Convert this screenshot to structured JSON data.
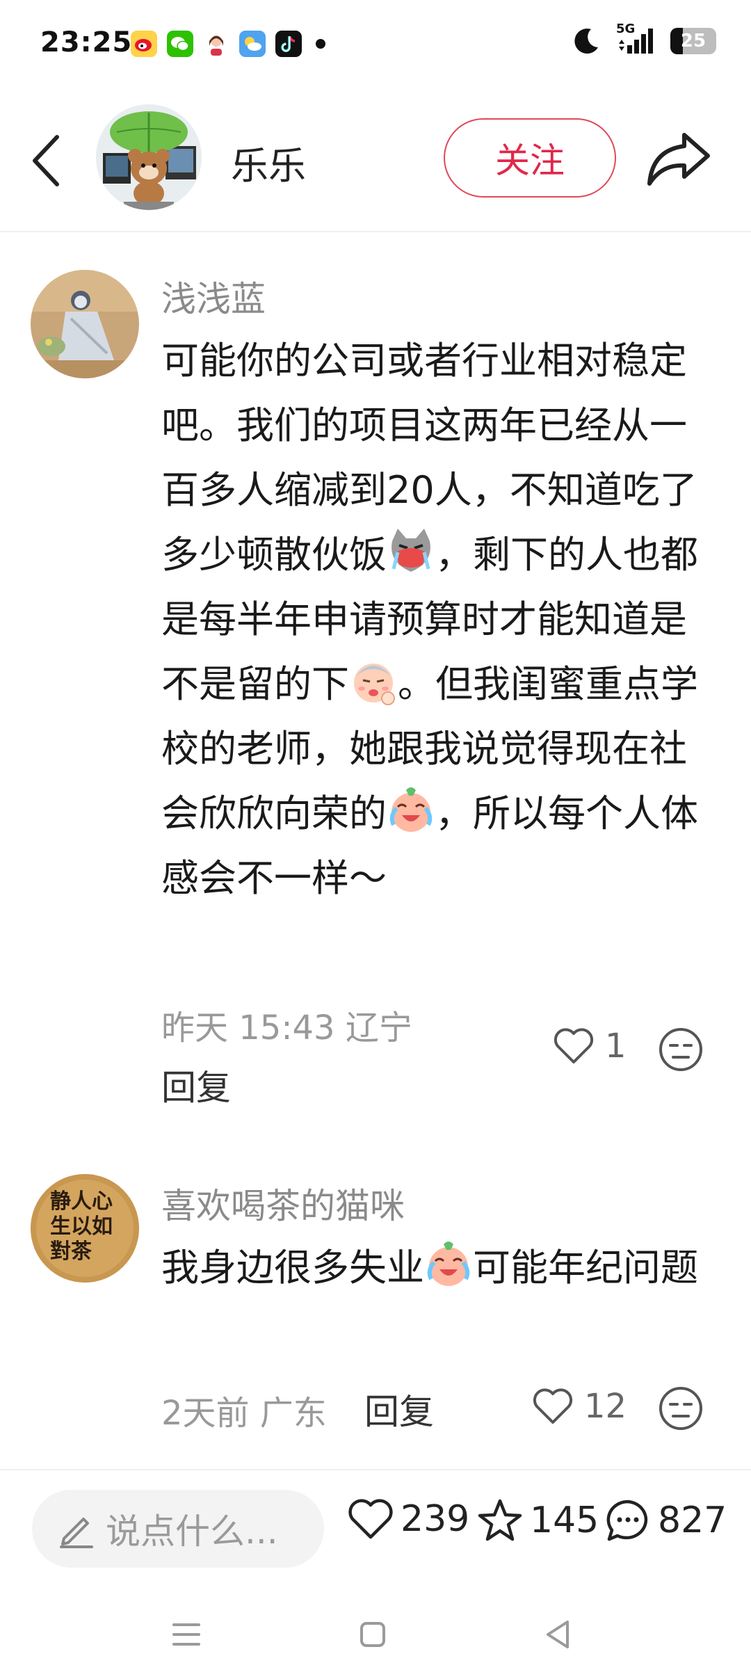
{
  "status_bar": {
    "time": "23:25",
    "network": "5G",
    "battery": "25",
    "app_icons": [
      "weibo-icon",
      "wechat-icon",
      "avatar-app-icon",
      "weather-icon",
      "tiktok-icon"
    ]
  },
  "header": {
    "username": "乐乐",
    "follow_label": "关注"
  },
  "comments": [
    {
      "author": "浅浅蓝",
      "text_parts": [
        "可能你的公司或者行业相对稳定吧。我们的项目这两年已经从一百多人缩减到20人，不知道吃了多少顿散伙饭",
        "，剩下的人也都是每半年申请预算时才能知道是不是留的下",
        "。但我闺蜜重点学校的老师，她跟我说觉得现在社会欣欣向荣的",
        "，所以每个人体感会不一样～"
      ],
      "meta": "昨天 15:43 辽宁",
      "reply_label": "回复",
      "likes": "1"
    },
    {
      "author": "喜欢喝茶的猫咪",
      "text_parts": [
        "我身边很多失业",
        "可能年纪问题"
      ],
      "meta": "2天前 广东",
      "reply_label": "回复",
      "likes": "12",
      "avatar_text": "静人心生以如對茶"
    }
  ],
  "bottom_bar": {
    "input_placeholder": "说点什么...",
    "likes": "239",
    "favorites": "145",
    "comments": "827"
  },
  "colors": {
    "accent": "#e0284a",
    "secondary_text": "#8a8a8a"
  }
}
